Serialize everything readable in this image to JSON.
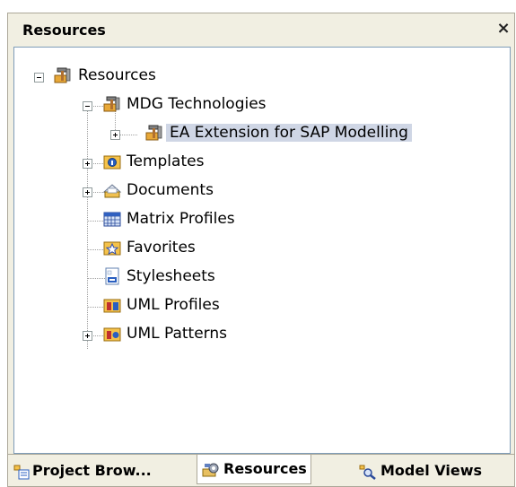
{
  "panel": {
    "title": "Resources",
    "close_glyph": "×"
  },
  "tree": {
    "root": {
      "label": "Resources",
      "icon": "hammer-wrench-icon",
      "expanded": true
    },
    "mdg": {
      "label": "MDG Technologies",
      "icon": "hammer-wrench-icon",
      "expanded": true
    },
    "ea_ext": {
      "label": "EA Extension for SAP Modelling",
      "icon": "hammer-wrench-icon",
      "expanded": false,
      "selected": true
    },
    "templates": {
      "label": "Templates",
      "icon": "templates-icon",
      "expanded": false
    },
    "documents": {
      "label": "Documents",
      "icon": "documents-icon",
      "expanded": false
    },
    "matrix_profiles": {
      "label": "Matrix Profiles",
      "icon": "matrix-icon"
    },
    "favorites": {
      "label": "Favorites",
      "icon": "favorites-star-icon"
    },
    "stylesheets": {
      "label": "Stylesheets",
      "icon": "stylesheet-icon"
    },
    "uml_profiles": {
      "label": "UML Profiles",
      "icon": "uml-profile-icon"
    },
    "uml_patterns": {
      "label": "UML Patterns",
      "icon": "uml-pattern-icon",
      "expanded": false
    }
  },
  "tabs": {
    "project_browser": "Project Brow...",
    "resources": "Resources",
    "model_views": "Model Views"
  }
}
